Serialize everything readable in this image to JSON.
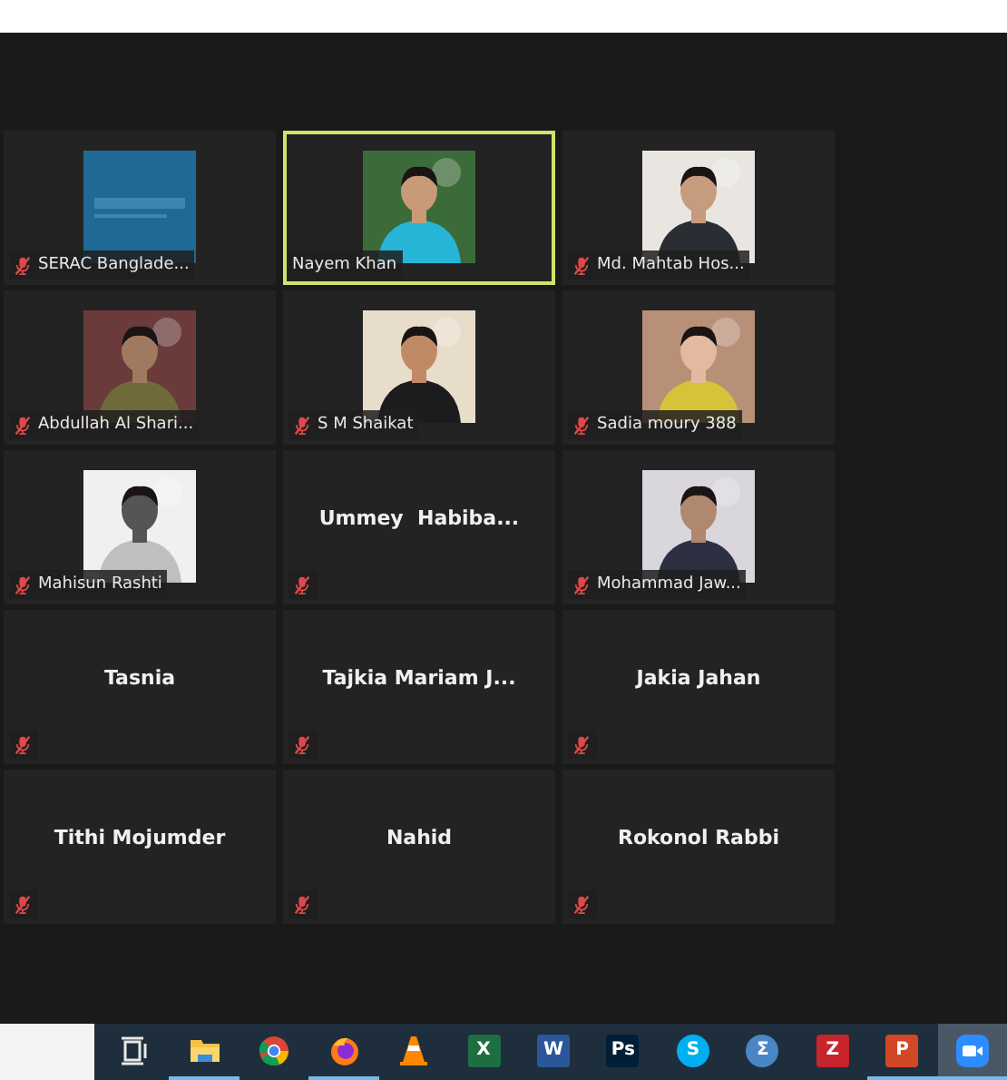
{
  "gallery": [
    {
      "name": "SERAC Banglade...",
      "muted": true,
      "speaking": false
    },
    {
      "name": "Nayem Khan",
      "muted": false,
      "speaking": true
    },
    {
      "name": "Md. Mahtab Hos...",
      "muted": true,
      "speaking": false
    },
    {
      "name": "Abdullah Al Shari...",
      "muted": true,
      "speaking": false
    },
    {
      "name": "S M Shaikat",
      "muted": true,
      "speaking": false
    },
    {
      "name": "Sadia moury 388",
      "muted": true,
      "speaking": false
    },
    {
      "name": "Mahisun Rashti",
      "muted": true,
      "speaking": false
    },
    {
      "kind": "name",
      "name": "Ummey  Habiba...",
      "muted": true,
      "speaking": false
    },
    {
      "name": "Mohammad Jaw...",
      "muted": true,
      "speaking": false
    },
    {
      "kind": "name",
      "name": "Tasnia",
      "muted": true,
      "speaking": false
    },
    {
      "kind": "name",
      "name": "Tajkia Mariam J...",
      "muted": true,
      "speaking": false
    },
    {
      "kind": "name",
      "name": "Jakia Jahan",
      "muted": true,
      "speaking": false
    },
    {
      "kind": "name",
      "name": "Tithi Mojumder",
      "muted": true,
      "speaking": false
    },
    {
      "kind": "name",
      "name": "Nahid",
      "muted": true,
      "speaking": false
    },
    {
      "kind": "name",
      "name": "Rokonol Rabbi",
      "muted": true,
      "speaking": false
    }
  ],
  "taskbar": [
    {
      "kind": "taskview",
      "running": false,
      "selected": false
    },
    {
      "kind": "folder",
      "running": true,
      "selected": false
    },
    {
      "kind": "chrome",
      "running": false,
      "selected": false
    },
    {
      "kind": "firefox",
      "running": true,
      "selected": false
    },
    {
      "kind": "cone",
      "running": false,
      "selected": false
    },
    {
      "kind": "tile",
      "glyph": "X",
      "color": "#1d6f42",
      "running": false,
      "selected": false
    },
    {
      "kind": "tile",
      "glyph": "W",
      "color": "#2b579a",
      "running": false,
      "selected": false
    },
    {
      "kind": "tile",
      "glyph": "Ps",
      "color": "#001e36",
      "running": false,
      "selected": false
    },
    {
      "kind": "round",
      "glyph": "S",
      "color": "#00aff0",
      "running": false,
      "selected": false
    },
    {
      "kind": "round",
      "glyph": "Σ",
      "color": "#4a86c5",
      "running": false,
      "selected": false
    },
    {
      "kind": "tile",
      "glyph": "Z",
      "color": "#c8242b",
      "running": false,
      "selected": false
    },
    {
      "kind": "tile",
      "glyph": "P",
      "color": "#d24726",
      "running": true,
      "selected": false
    },
    {
      "kind": "camera",
      "running": true,
      "selected": true
    }
  ]
}
